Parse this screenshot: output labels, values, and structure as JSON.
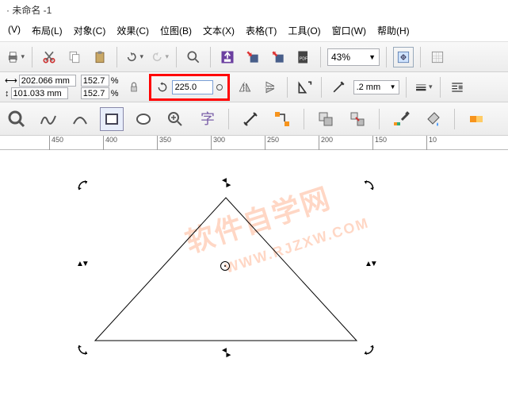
{
  "title": "· 未命名 -1",
  "menu": {
    "view": "(V)",
    "layout": "布局(L)",
    "object": "对象(C)",
    "effects": "效果(C)",
    "bitmap": "位图(B)",
    "text": "文本(X)",
    "table": "表格(T)",
    "tools": "工具(O)",
    "window": "窗口(W)",
    "help": "帮助(H)"
  },
  "toolbar1": {
    "zoom_value": "43%"
  },
  "props": {
    "x_label": "⟷",
    "y_label": "↕",
    "x_value": "202.066 mm",
    "y_value": "101.033 mm",
    "scale_x": "152.7",
    "scale_y": "152.7",
    "percent": "%",
    "rotation": "225.0",
    "outline_width": ".2 mm"
  },
  "ruler_ticks": [
    "450",
    "400",
    "350",
    "300",
    "250",
    "200",
    "150",
    "10"
  ],
  "ruler_positions": [
    62,
    130,
    198,
    266,
    334,
    402,
    470,
    538
  ]
}
